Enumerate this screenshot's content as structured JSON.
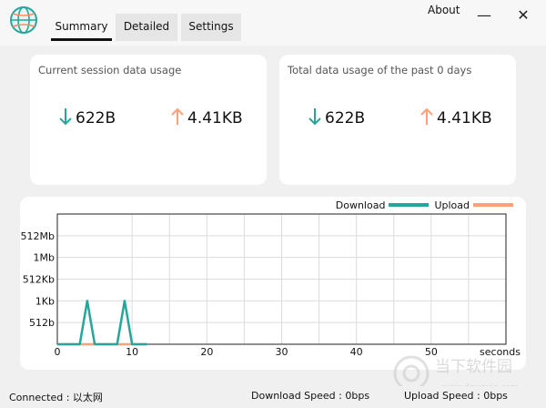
{
  "header": {
    "tabs": [
      {
        "label": "Summary",
        "active": true
      },
      {
        "label": "Detailed",
        "active": false
      },
      {
        "label": "Settings",
        "active": false
      }
    ],
    "about_label": "About",
    "minimize_glyph": "—",
    "close_glyph": "✕"
  },
  "summary": {
    "session": {
      "title": "Current session data usage",
      "download": "622B",
      "upload": "4.41KB"
    },
    "total": {
      "title": "Total data usage of the past 0 days",
      "download": "622B",
      "upload": "4.41KB"
    }
  },
  "chart_data": {
    "type": "line",
    "title": "",
    "xlabel": "seconds",
    "ylabel": "",
    "xlim": [
      0,
      60
    ],
    "x_ticks": [
      0,
      10,
      20,
      30,
      40,
      50
    ],
    "y_ticks": [
      "512b",
      "1Kb",
      "512Kb",
      "1Mb",
      "512Mb"
    ],
    "grid": true,
    "legend_position": "top-right",
    "series": [
      {
        "name": "Download",
        "color": "#26a69a",
        "x": [
          0,
          3,
          4,
          5,
          8,
          9,
          10,
          12
        ],
        "y_level": [
          0,
          0,
          2,
          0,
          0,
          2,
          0,
          0
        ]
      },
      {
        "name": "Upload",
        "color": "#ffa07a",
        "x": [
          0,
          12
        ],
        "y_level": [
          0,
          0
        ]
      }
    ]
  },
  "status": {
    "connected": "Connected : 以太网",
    "download_speed": "Download Speed : 0bps",
    "upload_speed": "Upload Speed : 0bps"
  },
  "watermark": {
    "text": "当下软件园",
    "url": "www.downxia.com"
  },
  "colors": {
    "download": "#26a69a",
    "upload": "#ffa07a"
  }
}
